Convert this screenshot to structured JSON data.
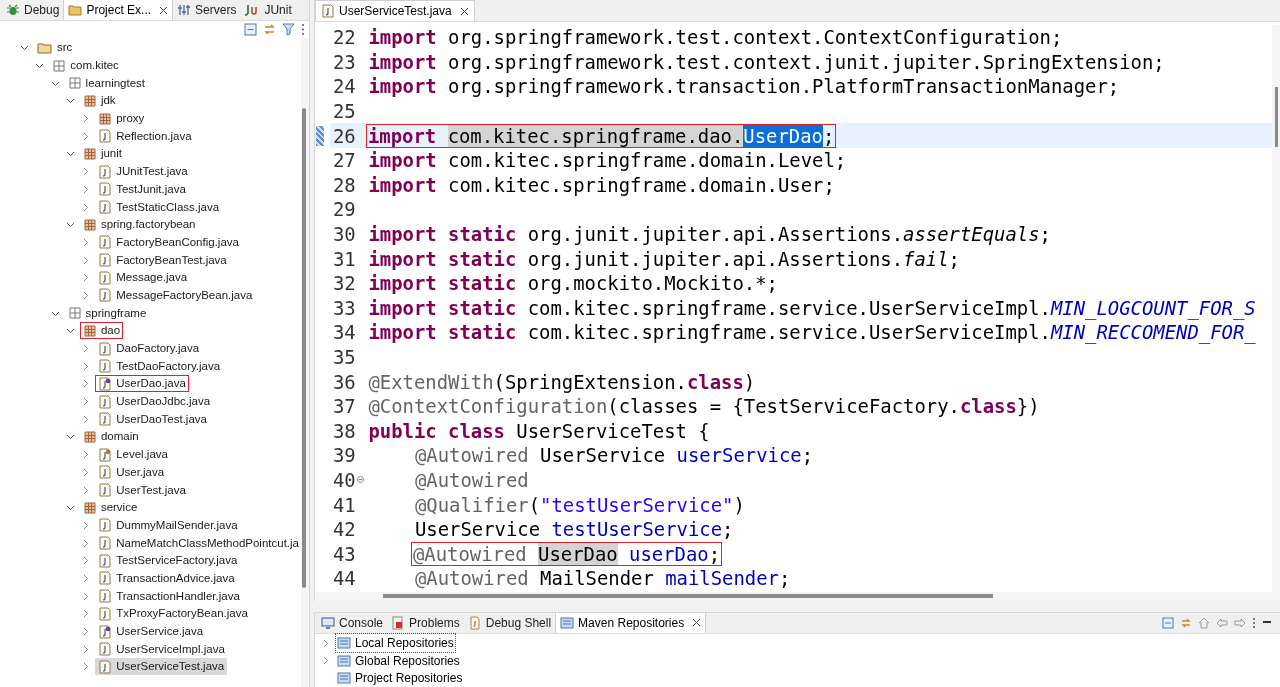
{
  "left_panel": {
    "tabs": [
      {
        "label": "Debug",
        "kind": "debug",
        "selected": false,
        "closable": false
      },
      {
        "label": "Project Ex...",
        "kind": "project",
        "selected": true,
        "closable": true
      },
      {
        "label": "Servers",
        "kind": "servers",
        "selected": false,
        "closable": false
      },
      {
        "label": "JUnit",
        "kind": "junit",
        "selected": false,
        "closable": false
      }
    ],
    "tree": [
      {
        "label": "src",
        "kind": "source-folder",
        "expanded": true,
        "children": [
          {
            "label": "com.kitec",
            "kind": "package-root",
            "expanded": true,
            "children": [
              {
                "label": "learningtest",
                "kind": "package-root",
                "expanded": true,
                "children": [
                  {
                    "label": "jdk",
                    "kind": "package",
                    "expanded": true,
                    "children": [
                      {
                        "label": "proxy",
                        "kind": "package",
                        "expanded": false
                      },
                      {
                        "label": "Reflection.java",
                        "kind": "java",
                        "expanded": false
                      }
                    ]
                  },
                  {
                    "label": "junit",
                    "kind": "package",
                    "expanded": true,
                    "children": [
                      {
                        "label": "JUnitTest.java",
                        "kind": "java",
                        "expanded": false
                      },
                      {
                        "label": "TestJunit.java",
                        "kind": "java",
                        "expanded": false
                      },
                      {
                        "label": "TestStaticClass.java",
                        "kind": "java",
                        "expanded": false
                      }
                    ]
                  },
                  {
                    "label": "spring.factorybean",
                    "kind": "package",
                    "expanded": true,
                    "children": [
                      {
                        "label": "FactoryBeanConfig.java",
                        "kind": "java",
                        "expanded": false
                      },
                      {
                        "label": "FactoryBeanTest.java",
                        "kind": "java",
                        "expanded": false
                      },
                      {
                        "label": "Message.java",
                        "kind": "java",
                        "expanded": false
                      },
                      {
                        "label": "MessageFactoryBean.java",
                        "kind": "java",
                        "expanded": false
                      }
                    ]
                  }
                ]
              },
              {
                "label": "springframe",
                "kind": "package-root",
                "expanded": true,
                "children": [
                  {
                    "label": "dao",
                    "kind": "package",
                    "expanded": true,
                    "marked": true,
                    "children": [
                      {
                        "label": "DaoFactory.java",
                        "kind": "java",
                        "expanded": false
                      },
                      {
                        "label": "TestDaoFactory.java",
                        "kind": "java",
                        "expanded": false
                      },
                      {
                        "label": "UserDao.java",
                        "kind": "interface",
                        "expanded": false,
                        "marked": true
                      },
                      {
                        "label": "UserDaoJdbc.java",
                        "kind": "java",
                        "expanded": false
                      },
                      {
                        "label": "UserDaoTest.java",
                        "kind": "java",
                        "expanded": false
                      }
                    ]
                  },
                  {
                    "label": "domain",
                    "kind": "package",
                    "expanded": true,
                    "children": [
                      {
                        "label": "Level.java",
                        "kind": "enum",
                        "expanded": false
                      },
                      {
                        "label": "User.java",
                        "kind": "java",
                        "expanded": false
                      },
                      {
                        "label": "UserTest.java",
                        "kind": "java",
                        "expanded": false
                      }
                    ]
                  },
                  {
                    "label": "service",
                    "kind": "package",
                    "expanded": true,
                    "children": [
                      {
                        "label": "DummyMailSender.java",
                        "kind": "java",
                        "expanded": false
                      },
                      {
                        "label": "NameMatchClassMethodPointcut.ja",
                        "kind": "java",
                        "expanded": false
                      },
                      {
                        "label": "TestServiceFactory.java",
                        "kind": "java",
                        "expanded": false
                      },
                      {
                        "label": "TransactionAdvice.java",
                        "kind": "java",
                        "expanded": false
                      },
                      {
                        "label": "TransactionHandler.java",
                        "kind": "java",
                        "expanded": false
                      },
                      {
                        "label": "TxProxyFactoryBean.java",
                        "kind": "java",
                        "expanded": false
                      },
                      {
                        "label": "UserService.java",
                        "kind": "interface",
                        "expanded": false
                      },
                      {
                        "label": "UserServiceImpl.java",
                        "kind": "java",
                        "expanded": false
                      },
                      {
                        "label": "UserServiceTest.java",
                        "kind": "java",
                        "expanded": false,
                        "selected": true
                      }
                    ]
                  }
                ]
              }
            ]
          }
        ]
      }
    ]
  },
  "editor": {
    "tab": {
      "label": "UserServiceTest.java",
      "selected": true
    },
    "lines": [
      {
        "number": "22",
        "tokens": [
          {
            "kind": "keyword",
            "text": "import"
          },
          {
            "kind": "plain",
            "text": " org.springframework.test.context.ContextConfiguration;"
          }
        ]
      },
      {
        "number": "23",
        "tokens": [
          {
            "kind": "keyword",
            "text": "import"
          },
          {
            "kind": "plain",
            "text": " org.springframework.test.context.junit.jupiter.SpringExtension;"
          }
        ]
      },
      {
        "number": "24",
        "tokens": [
          {
            "kind": "keyword",
            "text": "import"
          },
          {
            "kind": "plain",
            "text": " org.springframework.transaction.PlatformTransactionManager;"
          }
        ]
      },
      {
        "number": "25"
      },
      {
        "number": "26",
        "current": true,
        "marked": true,
        "tokens": [
          {
            "kind": "keyword",
            "text": "import "
          },
          {
            "kind": "occurrence",
            "text": "com.kitec.springframe.dao."
          },
          {
            "kind": "selection",
            "text": "UserDao"
          },
          {
            "kind": "plain",
            "text": ";"
          }
        ]
      },
      {
        "number": "27",
        "tokens": [
          {
            "kind": "keyword",
            "text": "import"
          },
          {
            "kind": "plain",
            "text": " com.kitec.springframe.domain.Level;"
          }
        ]
      },
      {
        "number": "28",
        "tokens": [
          {
            "kind": "keyword",
            "text": "import"
          },
          {
            "kind": "plain",
            "text": " com.kitec.springframe.domain.User;"
          }
        ]
      },
      {
        "number": "29"
      },
      {
        "number": "30",
        "tokens": [
          {
            "kind": "keyword",
            "text": "import static"
          },
          {
            "kind": "plain",
            "text": " org.junit.jupiter.api.Assertions."
          },
          {
            "kind": "static-method",
            "text": "assertEquals"
          },
          {
            "kind": "plain",
            "text": ";"
          }
        ]
      },
      {
        "number": "31",
        "tokens": [
          {
            "kind": "keyword",
            "text": "import static"
          },
          {
            "kind": "plain",
            "text": " org.junit.jupiter.api.Assertions."
          },
          {
            "kind": "static-method",
            "text": "fail"
          },
          {
            "kind": "plain",
            "text": ";"
          }
        ]
      },
      {
        "number": "32",
        "tokens": [
          {
            "kind": "keyword",
            "text": "import static"
          },
          {
            "kind": "plain",
            "text": " org.mockito.Mockito.*;"
          }
        ]
      },
      {
        "number": "33",
        "tokens": [
          {
            "kind": "keyword",
            "text": "import static"
          },
          {
            "kind": "plain",
            "text": " com.kitec.springframe.service.UserServiceImpl."
          },
          {
            "kind": "static-field",
            "text": "MIN_LOGCOUNT_FOR_S"
          }
        ]
      },
      {
        "number": "34",
        "tokens": [
          {
            "kind": "keyword",
            "text": "import static"
          },
          {
            "kind": "plain",
            "text": " com.kitec.springframe.service.UserServiceImpl."
          },
          {
            "kind": "static-field",
            "text": "MIN_RECCOMEND_FOR_"
          }
        ]
      },
      {
        "number": "35"
      },
      {
        "number": "36",
        "tokens": [
          {
            "kind": "annotation",
            "text": "@ExtendWith"
          },
          {
            "kind": "plain",
            "text": "(SpringExtension."
          },
          {
            "kind": "keyword",
            "text": "class"
          },
          {
            "kind": "plain",
            "text": ")"
          }
        ]
      },
      {
        "number": "37",
        "tokens": [
          {
            "kind": "annotation",
            "text": "@ContextConfiguration"
          },
          {
            "kind": "plain",
            "text": "(classes = {TestServiceFactory."
          },
          {
            "kind": "keyword",
            "text": "class"
          },
          {
            "kind": "plain",
            "text": "})"
          }
        ]
      },
      {
        "number": "38",
        "tokens": [
          {
            "kind": "keyword",
            "text": "public class"
          },
          {
            "kind": "plain",
            "text": " UserServiceTest {"
          }
        ]
      },
      {
        "number": "39",
        "indented": true,
        "tokens": [
          {
            "kind": "annotation",
            "text": "@Autowired"
          },
          {
            "kind": "plain",
            "text": " UserService "
          },
          {
            "kind": "field",
            "text": "userService"
          },
          {
            "kind": "plain",
            "text": ";"
          }
        ]
      },
      {
        "number": "40",
        "indented": true,
        "foldable": true,
        "tokens": [
          {
            "kind": "annotation",
            "text": "@Autowired"
          }
        ]
      },
      {
        "number": "41",
        "indented": true,
        "tokens": [
          {
            "kind": "annotation",
            "text": "@Qualifier"
          },
          {
            "kind": "plain",
            "text": "("
          },
          {
            "kind": "string",
            "text": "\"testUserService\""
          },
          {
            "kind": "plain",
            "text": ")"
          }
        ]
      },
      {
        "number": "42",
        "indented": true,
        "tokens": [
          {
            "kind": "plain",
            "text": "UserService "
          },
          {
            "kind": "field",
            "text": "testUserService"
          },
          {
            "kind": "plain",
            "text": ";"
          }
        ]
      },
      {
        "number": "43",
        "indented": true,
        "marked": true,
        "tokens": [
          {
            "kind": "annotation",
            "text": "@Autowired "
          },
          {
            "kind": "occurrence",
            "text": "UserDao"
          },
          {
            "kind": "field",
            "text": " userDao"
          },
          {
            "kind": "plain",
            "text": ";"
          }
        ]
      },
      {
        "number": "44",
        "indented": true,
        "tokens": [
          {
            "kind": "annotation",
            "text": "@Autowired"
          },
          {
            "kind": "plain",
            "text": " MailSender "
          },
          {
            "kind": "field",
            "text": "mailSender"
          },
          {
            "kind": "plain",
            "text": ";"
          }
        ]
      }
    ]
  },
  "bottom_panel": {
    "tabs": [
      {
        "label": "Console",
        "kind": "console",
        "selected": false,
        "closable": false
      },
      {
        "label": "Problems",
        "kind": "problems",
        "selected": false,
        "closable": false
      },
      {
        "label": "Debug Shell",
        "kind": "debug-shell",
        "selected": false,
        "closable": false
      },
      {
        "label": "Maven Repositories",
        "kind": "maven",
        "selected": true,
        "closable": true
      }
    ],
    "rows": [
      {
        "label": "Local Repositories",
        "expandable": true,
        "focused": true
      },
      {
        "label": "Global Repositories",
        "expandable": true,
        "focused": false
      },
      {
        "label": "Project Repositories",
        "expandable": false,
        "focused": false
      }
    ]
  }
}
